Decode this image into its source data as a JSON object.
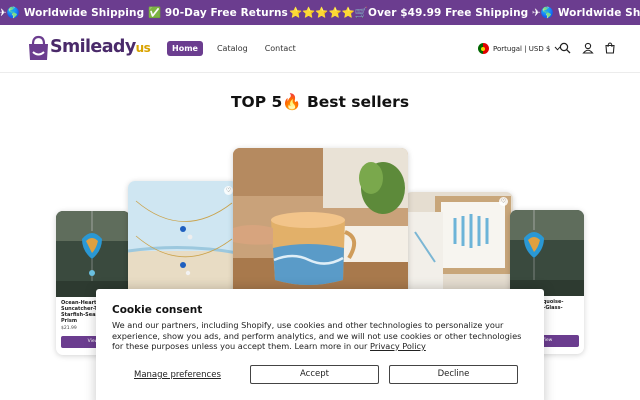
{
  "announcement": {
    "segment_a": "✈🌎 Worldwide Shipping ✅ 90-Day Free Returns",
    "segment_b": "⭐⭐⭐⭐⭐🛒Over $49.99 Free Shipping ✈🌎 Worldwide Shipping ✅"
  },
  "header": {
    "logo_main": "Smileady",
    "logo_suffix": "us",
    "nav": [
      {
        "label": "Home"
      },
      {
        "label": "Catalog"
      },
      {
        "label": "Contact"
      }
    ],
    "locale": "Portugal | USD $",
    "icons": [
      "search-icon",
      "account-icon",
      "cart-icon"
    ]
  },
  "section": {
    "title": "TOP 5🔥 Best sellers"
  },
  "products": [
    {
      "title": "Ocean-Heart-Suncatcher-Tree-Starfish-Seashell-Prism",
      "price": "$21.99",
      "button": "View"
    },
    {
      "title": "Beach Turquoise-Heart-Sea-Glass-",
      "button": "View"
    }
  ],
  "cookie": {
    "title": "Cookie consent",
    "body": "We and our partners, including Shopify, use cookies and other technologies to personalize your experience, show you ads, and perform analytics, and we will not use cookies or other technologies for these purposes unless you accept them. Learn more in our ",
    "privacy_link": "Privacy Policy",
    "manage": "Manage preferences",
    "accept": "Accept",
    "decline": "Decline"
  },
  "colors": {
    "brand": "#6b3d8f",
    "logo_accent": "#d9a300"
  }
}
